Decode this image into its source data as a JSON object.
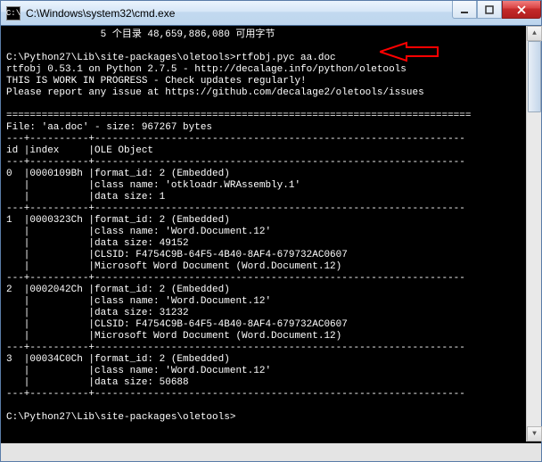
{
  "window": {
    "title": "C:\\Windows\\system32\\cmd.exe",
    "icon_label": "C:\\"
  },
  "terminal": {
    "line_dirs": "                5 个目录 48,659,886,080 可用字节",
    "blank": "",
    "prompt1": "C:\\Python27\\Lib\\site-packages\\oletools>rtfobj.pyc aa.doc",
    "line_app": "rtfobj 0.53.1 on Python 2.7.5 - http://decalage.info/python/oletools",
    "line_wip": "THIS IS WORK IN PROGRESS - Check updates regularly!",
    "line_issue": "Please report any issue at https://github.com/decalage2/oletools/issues",
    "rule1": "===============================================================================",
    "file_line": "File: 'aa.doc' - size: 967267 bytes",
    "sep_top": "---+----------+---------------------------------------------------------------",
    "hdr": "id |index     |OLE Object                                                     ",
    "sep_hdr": "---+----------+---------------------------------------------------------------",
    "r0a": "0  |0000109Bh |format_id: 2 (Embedded)                                        ",
    "r0b": "   |          |class name: 'otkloadr.WRAssembly.1'                            ",
    "r0c": "   |          |data size: 1                                                   ",
    "sep0": "---+----------+---------------------------------------------------------------",
    "r1a": "1  |0000323Ch |format_id: 2 (Embedded)                                        ",
    "r1b": "   |          |class name: 'Word.Document.12'                                 ",
    "r1c": "   |          |data size: 49152                                               ",
    "r1d": "   |          |CLSID: F4754C9B-64F5-4B40-8AF4-679732AC0607                    ",
    "r1e": "   |          |Microsoft Word Document (Word.Document.12)                     ",
    "sep1": "---+----------+---------------------------------------------------------------",
    "r2a": "2  |0002042Ch |format_id: 2 (Embedded)                                        ",
    "r2b": "   |          |class name: 'Word.Document.12'                                 ",
    "r2c": "   |          |data size: 31232                                               ",
    "r2d": "   |          |CLSID: F4754C9B-64F5-4B40-8AF4-679732AC0607                    ",
    "r2e": "   |          |Microsoft Word Document (Word.Document.12)                     ",
    "sep2": "---+----------+---------------------------------------------------------------",
    "r3a": "3  |00034C0Ch |format_id: 2 (Embedded)                                        ",
    "r3b": "   |          |class name: 'Word.Document.12'                                 ",
    "r3c": "   |          |data size: 50688                                               ",
    "sep3": "---+----------+---------------------------------------------------------------",
    "prompt2": "C:\\Python27\\Lib\\site-packages\\oletools>"
  }
}
